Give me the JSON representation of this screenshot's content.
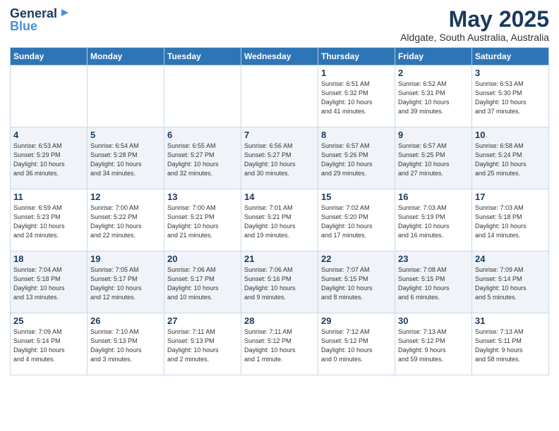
{
  "logo": {
    "general": "General",
    "blue": "Blue"
  },
  "title": "May 2025",
  "subtitle": "Aldgate, South Australia, Australia",
  "days_of_week": [
    "Sunday",
    "Monday",
    "Tuesday",
    "Wednesday",
    "Thursday",
    "Friday",
    "Saturday"
  ],
  "weeks": [
    [
      {
        "day": "",
        "info": ""
      },
      {
        "day": "",
        "info": ""
      },
      {
        "day": "",
        "info": ""
      },
      {
        "day": "",
        "info": ""
      },
      {
        "day": "1",
        "info": "Sunrise: 6:51 AM\nSunset: 5:32 PM\nDaylight: 10 hours\nand 41 minutes."
      },
      {
        "day": "2",
        "info": "Sunrise: 6:52 AM\nSunset: 5:31 PM\nDaylight: 10 hours\nand 39 minutes."
      },
      {
        "day": "3",
        "info": "Sunrise: 6:53 AM\nSunset: 5:30 PM\nDaylight: 10 hours\nand 37 minutes."
      }
    ],
    [
      {
        "day": "4",
        "info": "Sunrise: 6:53 AM\nSunset: 5:29 PM\nDaylight: 10 hours\nand 36 minutes."
      },
      {
        "day": "5",
        "info": "Sunrise: 6:54 AM\nSunset: 5:28 PM\nDaylight: 10 hours\nand 34 minutes."
      },
      {
        "day": "6",
        "info": "Sunrise: 6:55 AM\nSunset: 5:27 PM\nDaylight: 10 hours\nand 32 minutes."
      },
      {
        "day": "7",
        "info": "Sunrise: 6:56 AM\nSunset: 5:27 PM\nDaylight: 10 hours\nand 30 minutes."
      },
      {
        "day": "8",
        "info": "Sunrise: 6:57 AM\nSunset: 5:26 PM\nDaylight: 10 hours\nand 29 minutes."
      },
      {
        "day": "9",
        "info": "Sunrise: 6:57 AM\nSunset: 5:25 PM\nDaylight: 10 hours\nand 27 minutes."
      },
      {
        "day": "10",
        "info": "Sunrise: 6:58 AM\nSunset: 5:24 PM\nDaylight: 10 hours\nand 25 minutes."
      }
    ],
    [
      {
        "day": "11",
        "info": "Sunrise: 6:59 AM\nSunset: 5:23 PM\nDaylight: 10 hours\nand 24 minutes."
      },
      {
        "day": "12",
        "info": "Sunrise: 7:00 AM\nSunset: 5:22 PM\nDaylight: 10 hours\nand 22 minutes."
      },
      {
        "day": "13",
        "info": "Sunrise: 7:00 AM\nSunset: 5:21 PM\nDaylight: 10 hours\nand 21 minutes."
      },
      {
        "day": "14",
        "info": "Sunrise: 7:01 AM\nSunset: 5:21 PM\nDaylight: 10 hours\nand 19 minutes."
      },
      {
        "day": "15",
        "info": "Sunrise: 7:02 AM\nSunset: 5:20 PM\nDaylight: 10 hours\nand 17 minutes."
      },
      {
        "day": "16",
        "info": "Sunrise: 7:03 AM\nSunset: 5:19 PM\nDaylight: 10 hours\nand 16 minutes."
      },
      {
        "day": "17",
        "info": "Sunrise: 7:03 AM\nSunset: 5:18 PM\nDaylight: 10 hours\nand 14 minutes."
      }
    ],
    [
      {
        "day": "18",
        "info": "Sunrise: 7:04 AM\nSunset: 5:18 PM\nDaylight: 10 hours\nand 13 minutes."
      },
      {
        "day": "19",
        "info": "Sunrise: 7:05 AM\nSunset: 5:17 PM\nDaylight: 10 hours\nand 12 minutes."
      },
      {
        "day": "20",
        "info": "Sunrise: 7:06 AM\nSunset: 5:17 PM\nDaylight: 10 hours\nand 10 minutes."
      },
      {
        "day": "21",
        "info": "Sunrise: 7:06 AM\nSunset: 5:16 PM\nDaylight: 10 hours\nand 9 minutes."
      },
      {
        "day": "22",
        "info": "Sunrise: 7:07 AM\nSunset: 5:15 PM\nDaylight: 10 hours\nand 8 minutes."
      },
      {
        "day": "23",
        "info": "Sunrise: 7:08 AM\nSunset: 5:15 PM\nDaylight: 10 hours\nand 6 minutes."
      },
      {
        "day": "24",
        "info": "Sunrise: 7:09 AM\nSunset: 5:14 PM\nDaylight: 10 hours\nand 5 minutes."
      }
    ],
    [
      {
        "day": "25",
        "info": "Sunrise: 7:09 AM\nSunset: 5:14 PM\nDaylight: 10 hours\nand 4 minutes."
      },
      {
        "day": "26",
        "info": "Sunrise: 7:10 AM\nSunset: 5:13 PM\nDaylight: 10 hours\nand 3 minutes."
      },
      {
        "day": "27",
        "info": "Sunrise: 7:11 AM\nSunset: 5:13 PM\nDaylight: 10 hours\nand 2 minutes."
      },
      {
        "day": "28",
        "info": "Sunrise: 7:11 AM\nSunset: 5:12 PM\nDaylight: 10 hours\nand 1 minute."
      },
      {
        "day": "29",
        "info": "Sunrise: 7:12 AM\nSunset: 5:12 PM\nDaylight: 10 hours\nand 0 minutes."
      },
      {
        "day": "30",
        "info": "Sunrise: 7:13 AM\nSunset: 5:12 PM\nDaylight: 9 hours\nand 59 minutes."
      },
      {
        "day": "31",
        "info": "Sunrise: 7:13 AM\nSunset: 5:11 PM\nDaylight: 9 hours\nand 58 minutes."
      }
    ]
  ]
}
